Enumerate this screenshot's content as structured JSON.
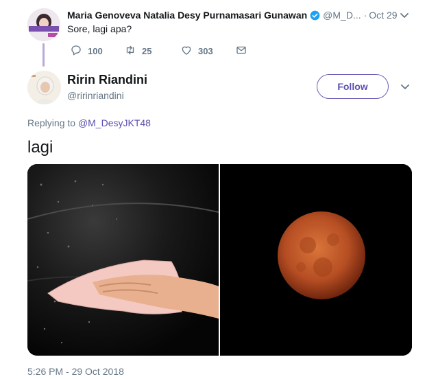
{
  "parent_tweet": {
    "name": "Maria Genoveva Natalia Desy Purnamasari Gunawan",
    "handle": "@M_D...",
    "separator": "·",
    "date": "Oct 29",
    "text": "Sore, lagi apa?",
    "reply_count": "100",
    "retweet_count": "25",
    "like_count": "303"
  },
  "tweet": {
    "author_name": "Ririn Riandini",
    "author_handle": "@ririnriandini",
    "follow_label": "Follow",
    "replying_prefix": "Replying to",
    "replying_handle": "@M_DesyJKT48",
    "text": "lagi",
    "timestamp": "5:26 PM - 29 Oct 2018"
  },
  "media": [
    {
      "icon": "car-polish-photo",
      "description_shown": "hand wiping car with cloth"
    },
    {
      "icon": "blood-moon-photo",
      "description_shown": "red lunar eclipse"
    }
  ],
  "colors": {
    "accent": "#5b4fb0",
    "muted": "#657786",
    "text": "#14171a",
    "thread_line": "#b9a9d8",
    "verified": "#1da1f2"
  }
}
